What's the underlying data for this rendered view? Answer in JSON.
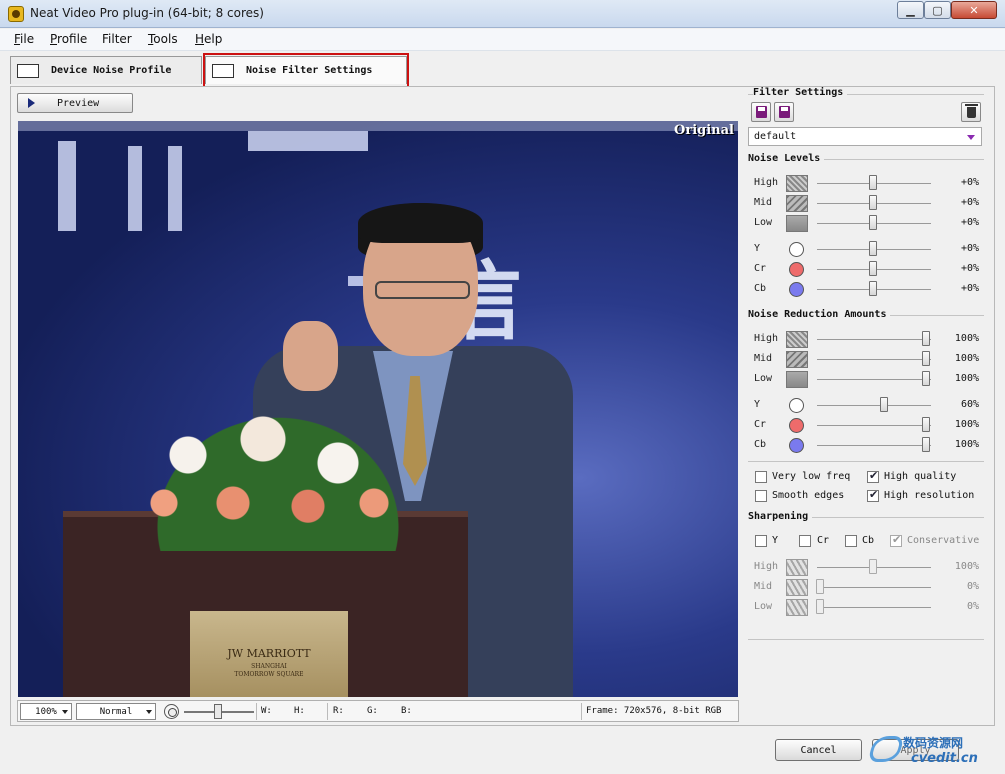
{
  "window": {
    "title": "Neat Video Pro plug-in (64-bit; 8 cores)"
  },
  "menu": [
    {
      "label": "File",
      "u": "F",
      "rest": "ile"
    },
    {
      "label": "Profile",
      "u": "P",
      "rest": "rofile"
    },
    {
      "label": "Filter",
      "u": "",
      "rest": "Filter"
    },
    {
      "label": "Tools",
      "u": "T",
      "rest": "ools"
    },
    {
      "label": "Help",
      "u": "H",
      "rest": "elp"
    }
  ],
  "tabs": {
    "device": "Device Noise Profile",
    "filter": "Noise Filter Settings"
  },
  "preview": {
    "button": "Preview",
    "overlay": "Original"
  },
  "video": {
    "plate_logo": "JW MARRIOTT",
    "plate_sub": "SHANGHAI\nTOMORROW SQUARE",
    "bg_text": "信 息"
  },
  "statusbar": {
    "zoom": "100%",
    "mode": "Normal",
    "w": "W:",
    "h": "H:",
    "r": "R:",
    "g": "G:",
    "b": "B:",
    "frame": "Frame: 720x576, 8-bit RGB"
  },
  "side": {
    "filter_settings": "Filter Settings",
    "preset": "default",
    "noise_levels": {
      "title": "Noise Levels",
      "rows": [
        {
          "label": "High",
          "value": "+0%",
          "level": 0.5
        },
        {
          "label": "Mid",
          "value": "+0%",
          "level": 0.5
        },
        {
          "label": "Low",
          "value": "+0%",
          "level": 0.5
        },
        {
          "label": "Y",
          "value": "+0%",
          "level": 0.5
        },
        {
          "label": "Cr",
          "value": "+0%",
          "level": 0.5
        },
        {
          "label": "Cb",
          "value": "+0%",
          "level": 0.5
        }
      ]
    },
    "reduction": {
      "title": "Noise Reduction Amounts",
      "rows": [
        {
          "label": "High",
          "value": "100%",
          "level": 1.0
        },
        {
          "label": "Mid",
          "value": "100%",
          "level": 1.0
        },
        {
          "label": "Low",
          "value": "100%",
          "level": 1.0
        },
        {
          "label": "Y",
          "value": "60%",
          "level": 0.6
        },
        {
          "label": "Cr",
          "value": "100%",
          "level": 1.0
        },
        {
          "label": "Cb",
          "value": "100%",
          "level": 1.0
        }
      ]
    },
    "options": {
      "very_low_freq": {
        "label": "Very low freq",
        "checked": false
      },
      "high_quality": {
        "label": "High quality",
        "checked": true
      },
      "smooth_edges": {
        "label": "Smooth edges",
        "checked": false
      },
      "high_resolution": {
        "label": "High resolution",
        "checked": true
      }
    },
    "sharpening": {
      "title": "Sharpening",
      "y": "Y",
      "cr": "Cr",
      "cb": "Cb",
      "conservative": "Conservative",
      "rows": [
        {
          "label": "High",
          "value": "100%",
          "level": 0.5
        },
        {
          "label": "Mid",
          "value": "0%",
          "level": 0.0
        },
        {
          "label": "Low",
          "value": "0%",
          "level": 0.0
        }
      ]
    }
  },
  "colors": {
    "cr": "#ee6b6b",
    "cb": "#7a7aee",
    "y": "#ffffff",
    "highlight": "#cc1111"
  },
  "buttons": {
    "cancel": "Cancel",
    "apply": "Apply"
  },
  "watermark": {
    "line1": "数码资源网",
    "line2": "cvedit.cn"
  }
}
